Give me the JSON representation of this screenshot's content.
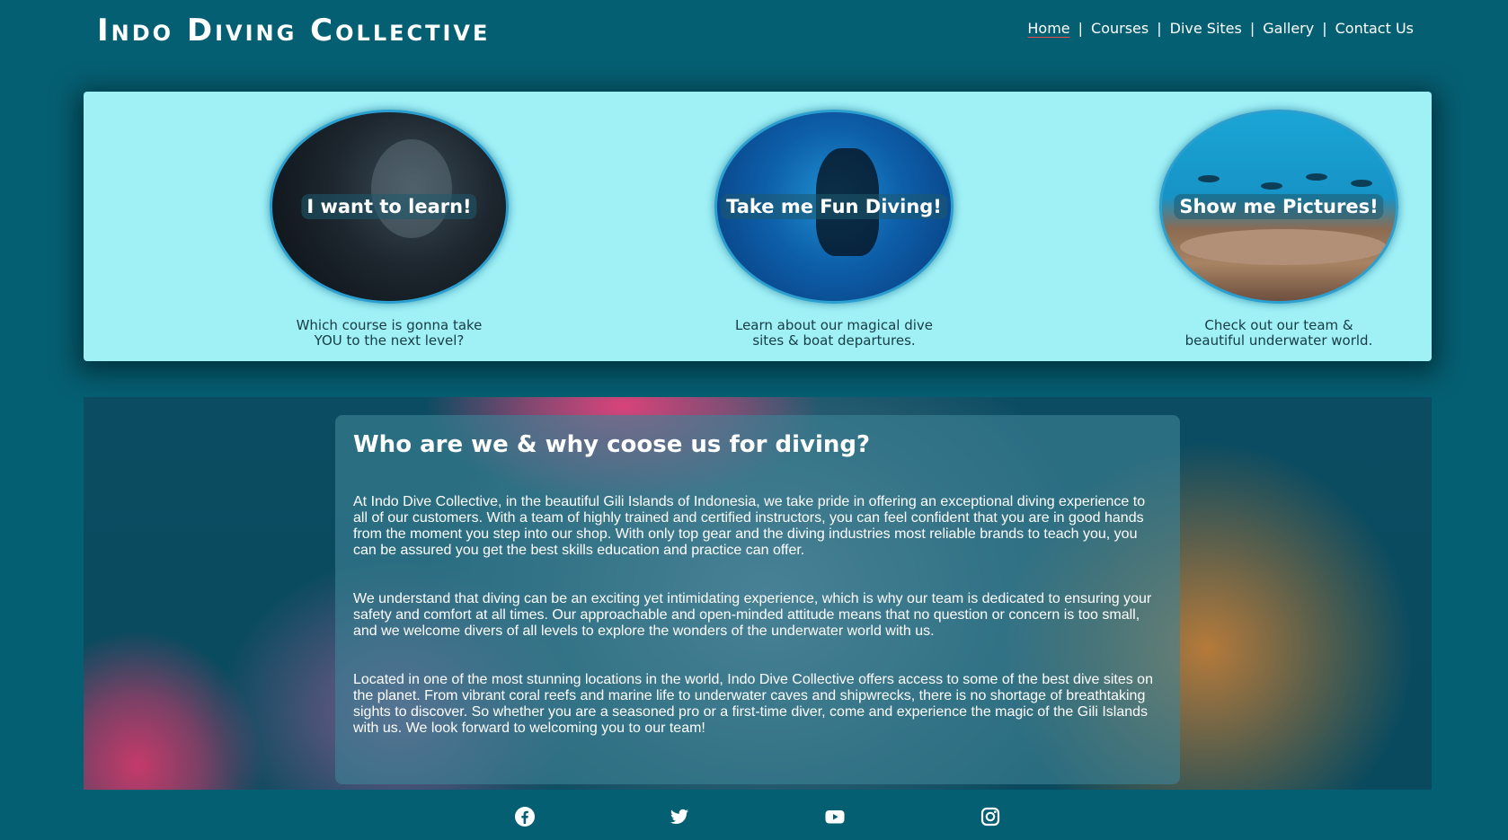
{
  "header": {
    "logo": "Indo Diving Collective",
    "nav": [
      {
        "label": "Home",
        "active": true
      },
      {
        "label": "Courses",
        "active": false
      },
      {
        "label": "Dive Sites",
        "active": false
      },
      {
        "label": "Gallery",
        "active": false
      },
      {
        "label": "Contact Us",
        "active": false
      }
    ]
  },
  "cards": [
    {
      "overlay": "I want to learn!",
      "caption_line1": "Which course is gonna take",
      "caption_line2": "YOU to the next level?"
    },
    {
      "overlay": "Take me Fun Diving!",
      "caption_line1": "Learn about our magical dive",
      "caption_line2": "sites & boat departures."
    },
    {
      "overlay": "Show me Pictures!",
      "caption_line1": "Check out our team &",
      "caption_line2": "beautiful underwater world."
    }
  ],
  "about": {
    "title": "Who are we & why coose us for diving?",
    "paragraphs": [
      "At Indo Dive Collective, in the beautiful Gili Islands of Indonesia, we take pride in offering an exceptional diving experience to all of our customers. With a team of highly trained and certified instructors, you can feel confident that you are in good hands from the moment you step into our shop. With only top gear and the diving industries most reliable brands to teach you, you can be assured you get the best skills education and practice can offer.",
      "We understand that diving can be an exciting yet intimidating experience, which is why our team is dedicated to ensuring your safety and comfort at all times. Our approachable and open-minded attitude means that no question or concern is too small, and we welcome divers of all levels to explore the wonders of the underwater world with us.",
      "Located in one of the most stunning locations in the world, Indo Dive Collective offers access to some of the best dive sites on the planet. From vibrant coral reefs and marine life to underwater caves and shipwrecks, there is no shortage of breathtaking sights to discover. So whether you are a seasoned pro or a first-time diver, come and experience the magic of the Gili Islands with us. We look forward to welcoming you to our team!"
    ]
  },
  "footer": {
    "social": [
      "facebook-icon",
      "twitter-icon",
      "youtube-icon",
      "instagram-icon"
    ]
  },
  "colors": {
    "background": "#055f72",
    "card_panel": "#9ff1f6",
    "caption_text": "#173c44",
    "nav_active_underline": "#e64a4a"
  }
}
